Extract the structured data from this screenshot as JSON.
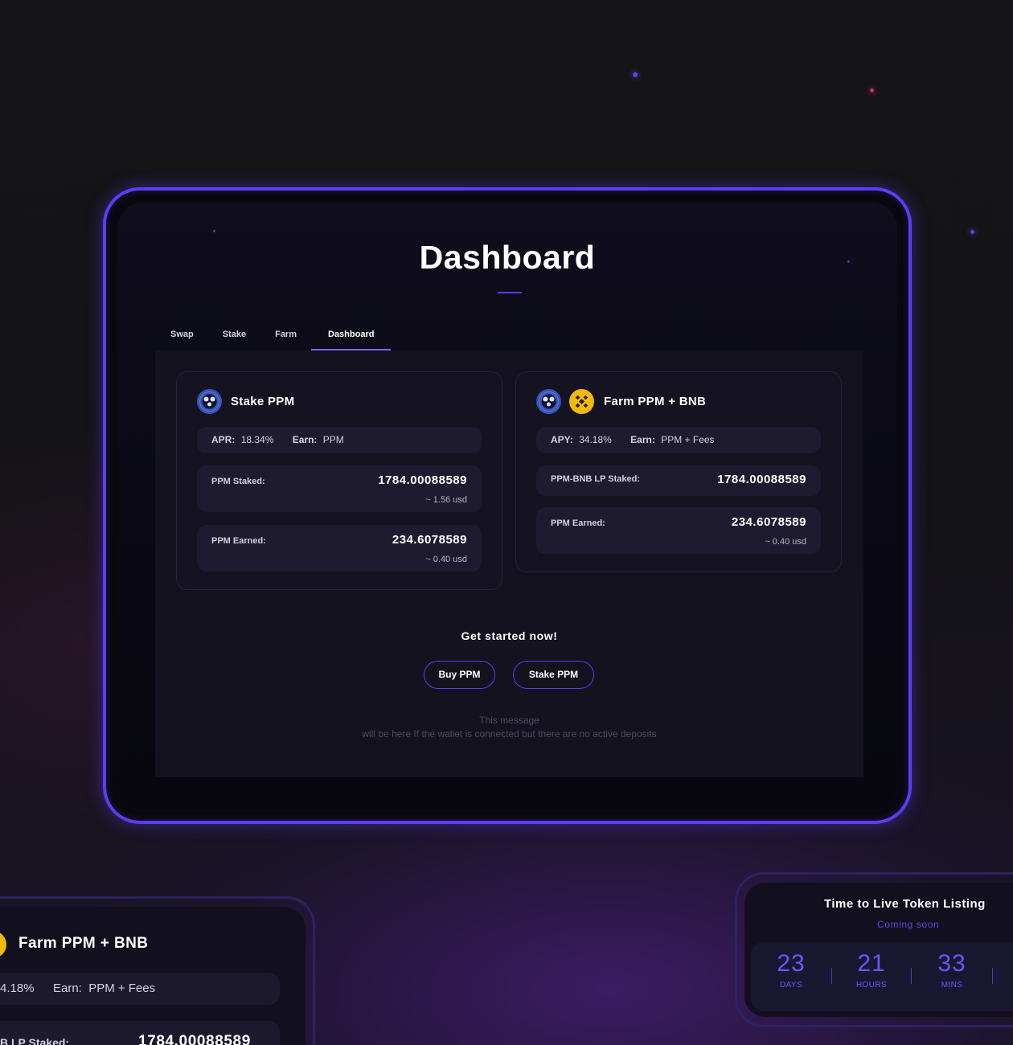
{
  "colors": {
    "accent": "#5b3df5",
    "accent_text": "#6a55ff",
    "background": "#141317",
    "card": "#151322",
    "ppm_token": "#3554b5",
    "bnb_token": "#f2b90c"
  },
  "dashboard": {
    "title": "Dashboard",
    "tabs": [
      {
        "label": "Swap"
      },
      {
        "label": "Stake"
      },
      {
        "label": "Farm"
      },
      {
        "label": "Dashboard"
      }
    ],
    "active_tab": "Dashboard"
  },
  "stake_card": {
    "icon": "ppm-token-icon",
    "title": "Stake PPM",
    "apr_label": "APR:",
    "apr_value": "18.34%",
    "earn_label": "Earn:",
    "earn_value": "PPM",
    "staked_label": "PPM Staked:",
    "staked_value": "1784.00088589",
    "staked_usd": "~ 1.56 usd",
    "earned_label": "PPM Earned:",
    "earned_value": "234.6078589",
    "earned_usd": "~ 0.40 usd"
  },
  "farm_card": {
    "icons": [
      "ppm-token-icon",
      "bnb-token-icon"
    ],
    "title": "Farm PPM + BNB",
    "apy_label": "APY:",
    "apy_value": "34.18%",
    "earn_label": "Earn:",
    "earn_value": "PPM + Fees",
    "staked_label": "PPM-BNB LP Staked:",
    "staked_value": "1784.00088589",
    "earned_label": "PPM Earned:",
    "earned_value": "234.6078589",
    "earned_usd": "~ 0.40 usd"
  },
  "cta": {
    "title": "Get started now!",
    "buy_label": "Buy PPM",
    "stake_label": "Stake PPM",
    "note_line1": "This message",
    "note_line2": "will be here If the wallet is connected but there are no active deposits"
  },
  "left_preview": {
    "title": "Farm PPM + BNB",
    "apy_value": "4.18%",
    "earn_label": "Earn:",
    "earn_value": "PPM + Fees",
    "staked_label": "B LP Staked:",
    "staked_value": "1784.00088589"
  },
  "timer_card": {
    "title": "Time to Live Token Listing",
    "subtitle": "Coming soon",
    "days": "23",
    "days_label": "DAYS",
    "hours": "21",
    "hours_label": "HOURS",
    "mins": "33",
    "mins_label": "MINS"
  }
}
